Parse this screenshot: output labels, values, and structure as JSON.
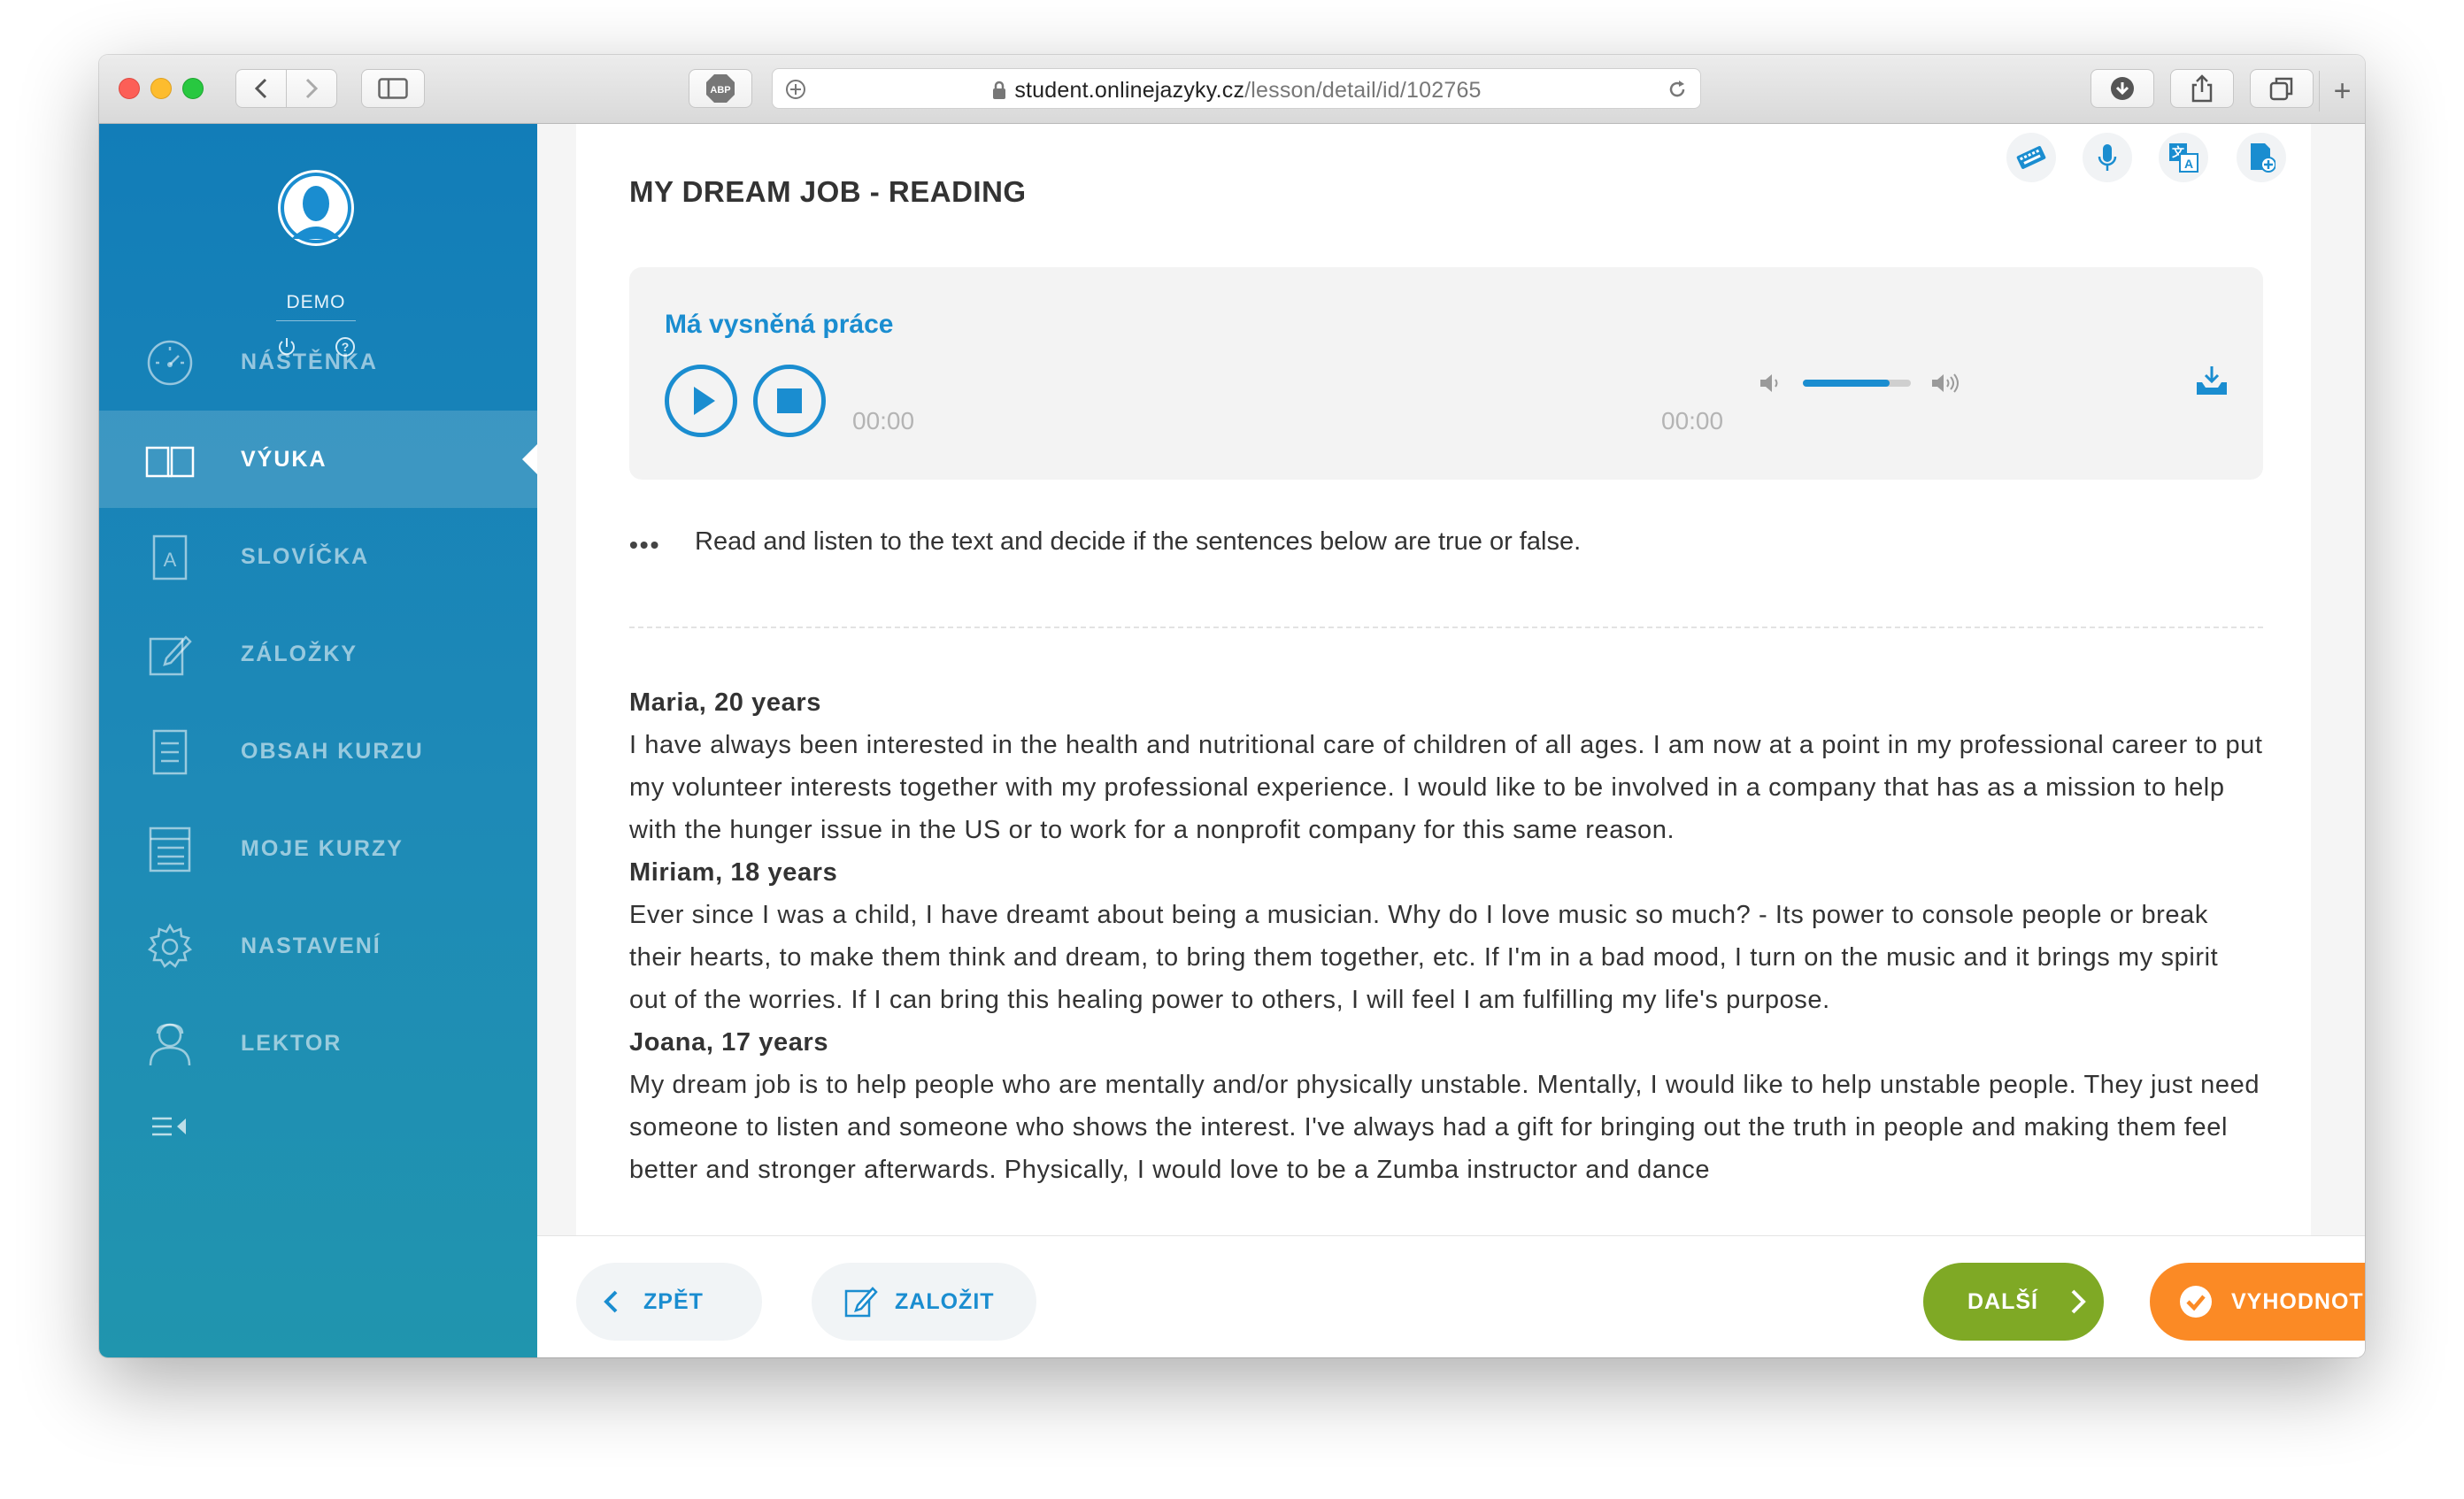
{
  "browser": {
    "url_host": "student.onlinejazyky.cz",
    "url_path": "/lesson/detail/id/102765"
  },
  "sidebar": {
    "user_name": "DEMO",
    "items": [
      {
        "label": "NÁSTĚNKA",
        "icon": "dashboard-gauge-icon"
      },
      {
        "label": "VÝUKA",
        "icon": "open-book-icon",
        "active": true
      },
      {
        "label": "SLOVÍČKA",
        "icon": "vocabulary-card-icon"
      },
      {
        "label": "ZÁLOŽKY",
        "icon": "bookmark-edit-icon"
      },
      {
        "label": "OBSAH KURZU",
        "icon": "document-list-icon"
      },
      {
        "label": "MOJE KURZY",
        "icon": "course-list-icon"
      },
      {
        "label": "NASTAVENÍ",
        "icon": "gear-icon"
      },
      {
        "label": "LEKTOR",
        "icon": "tutor-person-icon"
      }
    ]
  },
  "lesson": {
    "title": "MY DREAM JOB - READING",
    "audio_title": "Má vysněná práce",
    "time_current": "00:00",
    "time_total": "00:00",
    "volume_level": 0.8,
    "instruction": "Read and listen to the text and decide if the sentences below are true or false.",
    "paragraphs": [
      {
        "who": "Maria, 20 years",
        "text": "I have always been interested in the health and nutritional care of children of all ages. I am now at a point in my professional career to put my volunteer interests together with my professional experience. I would like to be involved in a company that has as a mission to help with the hunger issue in the US or to work for a nonprofit company for this same reason."
      },
      {
        "who": "Miriam, 18 years",
        "text": "Ever since I was a child, I have dreamt about being a musician. Why do I love music so much? - Its power to console people or break their hearts, to make them think and dream, to bring them together, etc. If I'm in a bad mood, I turn on the music and it brings my spirit out of the worries. If I can bring this healing power to others, I will feel I am fulfilling my life's purpose."
      },
      {
        "who": "Joana, 17 years",
        "text": "My dream job is to help people who are mentally and/or physically unstable. Mentally, I would like to help unstable people. They just need someone to listen and someone who shows the interest. I've always had a gift for bringing out the truth in people and making them feel better and stronger afterwards. Physically, I would love to be a Zumba instructor and dance"
      }
    ]
  },
  "footer": {
    "back": "ZPĚT",
    "bookmark": "ZALOŽIT",
    "next": "DALŠÍ",
    "evaluate": "VYHODNOTIT"
  },
  "colors": {
    "accent": "#1a8dd0",
    "sidebar": "#127db8",
    "next_green": "#7fa925",
    "evaluate_orange": "#fb8a25"
  }
}
